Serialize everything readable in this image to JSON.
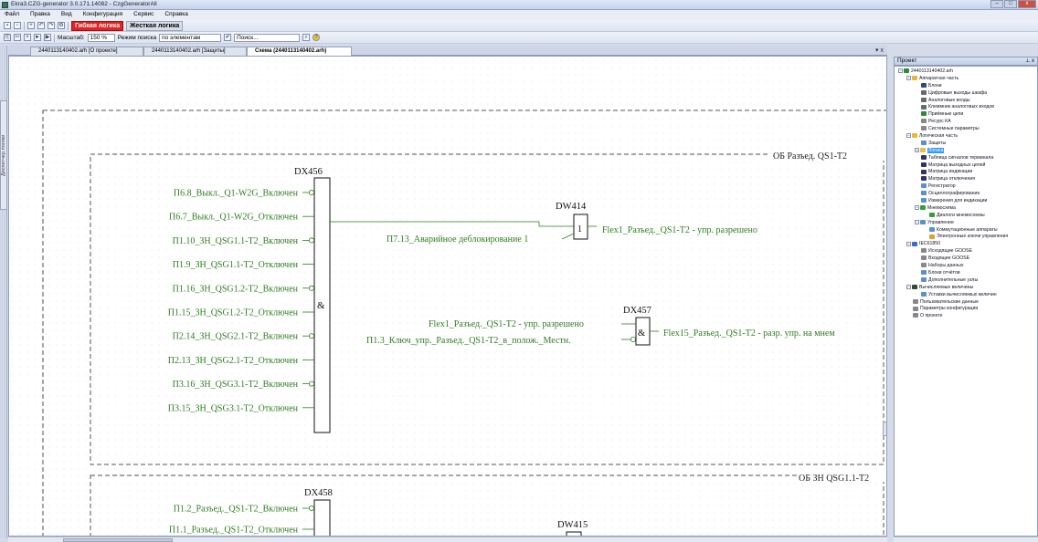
{
  "window": {
    "title": "Ekra3.CZG-generator 3.0.171.14082 - CzgGeneratorAll",
    "buttons": [
      "–",
      "□",
      "x"
    ]
  },
  "menu": [
    "Файл",
    "Правка",
    "Вид",
    "Конфигурация",
    "Сервис",
    "Справка"
  ],
  "toolbar": {
    "soft_logic": "Гибкая логика",
    "hard_logic": "Жесткая логика",
    "zoom_label": "Масштаб:",
    "zoom_value": "150 %",
    "search_mode_label": "Режим поиска",
    "search_mode_value": "по элементам",
    "search_placeholder": "Поиск...",
    "icons": [
      "save-icon",
      "open-icon",
      "new-icon",
      "undo-icon",
      "redo-icon",
      "build-icon",
      "copy-icon",
      "cut-icon",
      "delete-icon",
      "run-icon",
      "play-icon",
      "search-icon",
      "help-icon"
    ]
  },
  "left_panel": {
    "label": "Диспетчер логики"
  },
  "tabs": [
    {
      "label": "2440113140402.arh [О проекте]",
      "active": false
    },
    {
      "label": "2440113140402.arh [Защиты]",
      "active": false
    },
    {
      "label": "Схема (2440113140402.arh)",
      "active": true
    }
  ],
  "tab_close": "▾ x",
  "schematic": {
    "group1_title": "ОБ Разъед. QS1-T2",
    "group2_title": "ОБ ЗН QSG1.1-T2",
    "dx456": {
      "name": "DX456",
      "op": "&",
      "inputs": [
        {
          "label": "П6.8_Выкл._Q1-W2G_Включен",
          "inverted": true
        },
        {
          "label": "П6.7_Выкл._Q1-W2G_Отключен",
          "inverted": false
        },
        {
          "label": "П1.10_ЗН_QSG1.1-T2_Включен",
          "inverted": true
        },
        {
          "label": "П1.9_ЗН_QSG1.1-T2_Отключен",
          "inverted": false
        },
        {
          "label": "П1.16_ЗН_QSG1.2-T2_Включен",
          "inverted": true
        },
        {
          "label": "П1.15_ЗН_QSG1.2-T2_Отключен",
          "inverted": false
        },
        {
          "label": "П2.14_ЗН_QSG2.1-T2_Включен",
          "inverted": true
        },
        {
          "label": "П2.13_ЗН_QSG2.1-T2_Отключен",
          "inverted": false
        },
        {
          "label": "П3.16_ЗН_QSG3.1-T2_Включен",
          "inverted": true
        },
        {
          "label": "П3.15_ЗН_QSG3.1-T2_Отключен",
          "inverted": false
        }
      ]
    },
    "dw414": {
      "name": "DW414",
      "op": "1",
      "input": "П7.13_Аварийное деблокирование 1",
      "output": "Flex1_Разъед._QS1-T2 - упр. разрешено"
    },
    "dx457": {
      "name": "DX457",
      "op": "&",
      "inputs": [
        {
          "label": "Flex1_Разъед._QS1-T2 - упр. разрешено",
          "inverted": false
        },
        {
          "label": "П1.3_Ключ_упр._Разъед._QS1-T2_в_полож._Местн.",
          "inverted": true
        }
      ],
      "output": "Flex15_Разъед._QS1-T2 - разр. упр. на мнем"
    },
    "dx458": {
      "name": "DX458",
      "inputs": [
        {
          "label": "П1.2_Разъед._QS1-T2_Включен",
          "inverted": true
        },
        {
          "label": "П1.1_Разъед._QS1-T2_Отключен",
          "inverted": false
        }
      ]
    },
    "dw415": {
      "name": "DW415"
    },
    "colors": {
      "signal": "#2e7d1e",
      "line": "#2e7d1e",
      "block": "#000000",
      "group_border": "#555555"
    }
  },
  "project": {
    "header": "Проект",
    "tree": [
      {
        "label": "2440113140402.arh",
        "level": 0,
        "expander": "−",
        "icon": "project-icon",
        "color": "#2e8b3a"
      },
      {
        "label": "Аппаратная часть",
        "level": 1,
        "expander": "−",
        "icon": "folder-icon",
        "color": "#e6b83a"
      },
      {
        "label": "Блоки",
        "level": 2,
        "expander": "",
        "icon": "blocks-icon",
        "color": "#2a4d8a"
      },
      {
        "label": "Цифровые выходы шкафа",
        "level": 2,
        "expander": "",
        "icon": "digital-out-icon",
        "color": "#6a6a6a"
      },
      {
        "label": "Аналоговые входы",
        "level": 2,
        "expander": "",
        "icon": "analog-in-icon",
        "color": "#6a6a6a"
      },
      {
        "label": "Клеммник аналоговых входов",
        "level": 2,
        "expander": "",
        "icon": "terminal-icon",
        "color": "#6a6a6a"
      },
      {
        "label": "Приёмные цепи",
        "level": 2,
        "expander": "",
        "icon": "receive-icon",
        "color": "#2e8b3a"
      },
      {
        "label": "Ресурс КА",
        "level": 2,
        "expander": "",
        "icon": "resource-icon",
        "color": "#888888"
      },
      {
        "label": "Системные параметры",
        "level": 2,
        "expander": "",
        "icon": "params-icon",
        "color": "#888888"
      },
      {
        "label": "Логическая часть",
        "level": 1,
        "expander": "−",
        "icon": "folder-icon",
        "color": "#e6b83a"
      },
      {
        "label": "Защиты",
        "level": 2,
        "expander": "",
        "icon": "protection-icon",
        "color": "#5a8fd0"
      },
      {
        "label": "Логика",
        "level": 2,
        "expander": "+",
        "icon": "logic-icon",
        "color": "#e6c23a",
        "selected": true
      },
      {
        "label": "Таблица сигналов терминала",
        "level": 2,
        "expander": "",
        "icon": "table-icon",
        "color": "#333366"
      },
      {
        "label": "Матрица выходных цепей",
        "level": 2,
        "expander": "",
        "icon": "matrix-icon",
        "color": "#333366"
      },
      {
        "label": "Матрица индикации",
        "level": 2,
        "expander": "",
        "icon": "matrix-icon",
        "color": "#333366"
      },
      {
        "label": "Матрица отключения",
        "level": 2,
        "expander": "",
        "icon": "matrix-icon",
        "color": "#333366"
      },
      {
        "label": "Регистратор",
        "level": 2,
        "expander": "",
        "icon": "recorder-icon",
        "color": "#5a8fd0"
      },
      {
        "label": "Осциллографирование",
        "level": 2,
        "expander": "",
        "icon": "oscillograph-icon",
        "color": "#5a8fd0"
      },
      {
        "label": "Измерения для индикации",
        "level": 2,
        "expander": "",
        "icon": "measure-icon",
        "color": "#5a8fd0"
      },
      {
        "label": "Мнемосхема",
        "level": 2,
        "expander": "−",
        "icon": "mnemonic-icon",
        "color": "#3a9a3a"
      },
      {
        "label": "Диалоги мнемосхемы",
        "level": 3,
        "expander": "",
        "icon": "dialog-icon",
        "color": "#3a9a3a"
      },
      {
        "label": "Управление",
        "level": 2,
        "expander": "−",
        "icon": "control-icon",
        "color": "#5a8fd0"
      },
      {
        "label": "Коммутационные аппараты",
        "level": 3,
        "expander": "",
        "icon": "switch-icon",
        "color": "#5a8fd0"
      },
      {
        "label": "Электронные ключи управления",
        "level": 3,
        "expander": "",
        "icon": "key-icon",
        "color": "#d9a32a"
      },
      {
        "label": "IEC61850",
        "level": 1,
        "expander": "−",
        "icon": "iec-icon",
        "color": "#3a6ad0"
      },
      {
        "label": "Исходящие GOOSE",
        "level": 2,
        "expander": "",
        "icon": "goose-out-icon",
        "color": "#888888"
      },
      {
        "label": "Входящие GOOSE",
        "level": 2,
        "expander": "",
        "icon": "goose-in-icon",
        "color": "#888888"
      },
      {
        "label": "Наборы данных",
        "level": 2,
        "expander": "",
        "icon": "dataset-icon",
        "color": "#888888"
      },
      {
        "label": "Блоки отчётов",
        "level": 2,
        "expander": "",
        "icon": "reports-icon",
        "color": "#5a8fd0"
      },
      {
        "label": "Дополнительные узлы",
        "level": 2,
        "expander": "",
        "icon": "nodes-icon",
        "color": "#5a8fd0"
      },
      {
        "label": "Вычисляемые величины",
        "level": 1,
        "expander": "−",
        "icon": "calc-icon",
        "color": "#2a4d2a"
      },
      {
        "label": "Уставки вычисляемых величин",
        "level": 2,
        "expander": "",
        "icon": "settings-icon",
        "color": "#5a8fd0"
      },
      {
        "label": "Пользовательские данные",
        "level": 1,
        "expander": "",
        "icon": "user-data-icon",
        "color": "#888888"
      },
      {
        "label": "Параметры конфигурации",
        "level": 1,
        "expander": "",
        "icon": "config-icon",
        "color": "#888888"
      },
      {
        "label": "О проекте",
        "level": 1,
        "expander": "",
        "icon": "about-icon",
        "color": "#888888"
      }
    ]
  }
}
